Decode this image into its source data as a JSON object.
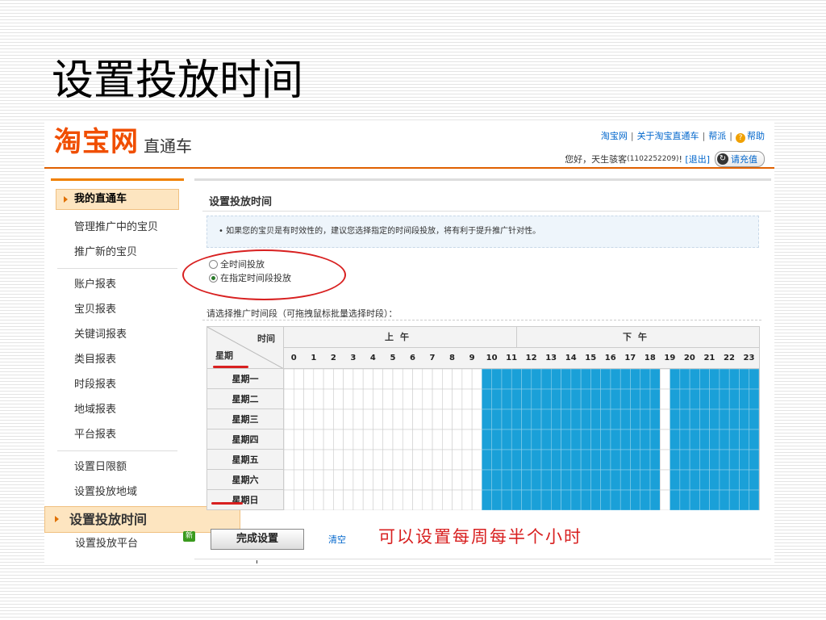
{
  "slide_title": "设置投放时间",
  "header": {
    "logo_main": "淘宝网",
    "logo_sub": "直通车",
    "links": [
      "淘宝网",
      "关于淘宝直通车",
      "帮派",
      "帮助"
    ],
    "greeting": "您好，天生骇客",
    "user_id": "(1102252209)",
    "exclaim": "!",
    "logout": "[退出]",
    "recharge": "请充值",
    "accent": "#f04e00"
  },
  "sidebar": {
    "head": "我的直通车",
    "groups": [
      [
        "管理推广中的宝贝",
        "推广新的宝贝"
      ],
      [
        "账户报表",
        "宝贝报表",
        "关键词报表",
        "类目报表",
        "时段报表",
        "地域报表",
        "平台报表"
      ],
      [
        "设置日限额",
        "设置投放地域"
      ]
    ],
    "active": "设置投放时间",
    "last": "设置投放平台",
    "new_badge": "新"
  },
  "main": {
    "title": "设置投放时间",
    "info": "• 如果您的宝贝是有时效性的，建议您选择指定的时间段投放，将有利于提升推广针对性。",
    "radio_all": "全时间投放",
    "radio_specific": "在指定时间段投放",
    "prompt": "请选择推广时间段（可拖拽鼠标批量选择时段）：",
    "corner_time": "时间",
    "corner_week": "星期",
    "am": "上午",
    "pm": "下午",
    "hours": [
      "0",
      "1",
      "2",
      "3",
      "4",
      "5",
      "6",
      "7",
      "8",
      "9",
      "10",
      "11",
      "12",
      "13",
      "14",
      "15",
      "16",
      "17",
      "18",
      "19",
      "20",
      "21",
      "22",
      "23"
    ],
    "days": [
      "星期一",
      "星期二",
      "星期三",
      "星期四",
      "星期五",
      "星期六",
      "星期日"
    ],
    "done_button": "完成设置",
    "clear_link": "清空",
    "note": "可以设置每周每半个小时",
    "selected_color": "#1aa0d8"
  },
  "schedule": {
    "slots_per_hour": 2,
    "selected_half_hour_ranges": [
      [
        20,
        38
      ],
      [
        39,
        48
      ]
    ]
  }
}
